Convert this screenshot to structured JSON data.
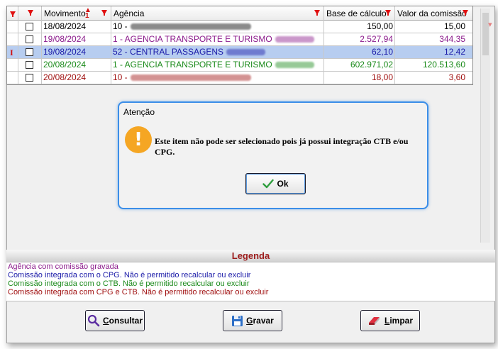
{
  "grid": {
    "columns": [
      {
        "key": "check",
        "label": ""
      },
      {
        "key": "movimento",
        "label": "Movimento",
        "sort_indicator": "1"
      },
      {
        "key": "agencia",
        "label": "Agência"
      },
      {
        "key": "base",
        "label": "Base de cálculo"
      },
      {
        "key": "comissao",
        "label": "Valor da comissão"
      }
    ],
    "rows": [
      {
        "date": "18/08/2024",
        "agencia": "10 -",
        "base": "150,00",
        "comissao": "15,00",
        "color": "#000000",
        "selected": false
      },
      {
        "date": "19/08/2024",
        "agencia": "1 - AGENCIA TRANSPORTE E TURISMO",
        "base": "2.527,94",
        "comissao": "344,35",
        "color": "#8b1a8b",
        "selected": false
      },
      {
        "date": "19/08/2024",
        "agencia": "52 - CENTRAL PASSAGENS",
        "base": "62,10",
        "comissao": "12,42",
        "color": "#1a1aa8",
        "selected": true,
        "indicator": "I"
      },
      {
        "date": "20/08/2024",
        "agencia": "1 - AGENCIA TRANSPORTE E TURISMO",
        "base": "602.971,02",
        "comissao": "120.513,60",
        "color": "#1a8a1a",
        "selected": false
      },
      {
        "date": "20/08/2024",
        "agencia": "10 -",
        "base": "18,00",
        "comissao": "3,60",
        "color": "#a01010",
        "selected": false
      }
    ]
  },
  "legend": {
    "title": "Legenda",
    "items": [
      {
        "text": "Agência com comissão gravada",
        "color": "#8b1a8b"
      },
      {
        "text": "Comissão integrada com o CPG. Não é permitido recalcular ou excluir",
        "color": "#1a1aa8"
      },
      {
        "text": "Comissão integrada com o CTB. Não é permitido recalcular ou excluir",
        "color": "#1a8a1a"
      },
      {
        "text": "Comissão integrada com CPG e CTB. Não é permitido recalcular ou excluir",
        "color": "#a01010"
      }
    ]
  },
  "buttons": {
    "consultar": {
      "label_first": "C",
      "label_rest": "onsultar",
      "icon": "magnifier-icon"
    },
    "gravar": {
      "label_first": "G",
      "label_rest": "ravar",
      "icon": "floppy-disk-icon"
    },
    "limpar": {
      "label_first": "L",
      "label_rest": "impar",
      "icon": "eraser-icon"
    }
  },
  "dialog": {
    "title": "Atenção",
    "icon_glyph": "!",
    "message": "Este item não pode ser selecionado pois já possui integração CTB e/ou CPG.",
    "ok_first": "O",
    "ok_rest": "k"
  },
  "colors": {
    "accent": "#3b8ee8",
    "warning": "#f5a623",
    "filter": "#e01010",
    "selection": "#b7cdf0"
  }
}
